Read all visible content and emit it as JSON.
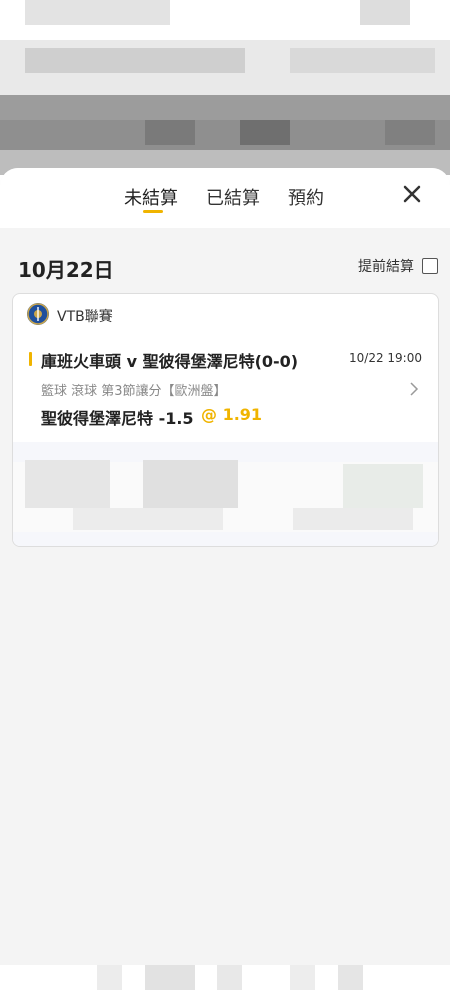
{
  "tabs": [
    {
      "label": "未結算",
      "active": true
    },
    {
      "label": "已結算",
      "active": false
    },
    {
      "label": "預約",
      "active": false
    }
  ],
  "close_icon": "close-icon",
  "date_header": "10月22日",
  "early_settle_label": "提前結算",
  "bet_card": {
    "league": "VTB聯賽",
    "match": "庫班火車頭 v 聖彼得堡澤尼特(0-0)",
    "time": "10/22 19:00",
    "meta": "籃球 滾球  第3節讓分【歐洲盤】",
    "selection": "聖彼得堡澤尼特 -1.5",
    "odds": "@ 1.91"
  },
  "colors": {
    "accent": "#f0b400",
    "sheet_bg": "#f4f4f4",
    "card_bg": "#ffffff"
  }
}
